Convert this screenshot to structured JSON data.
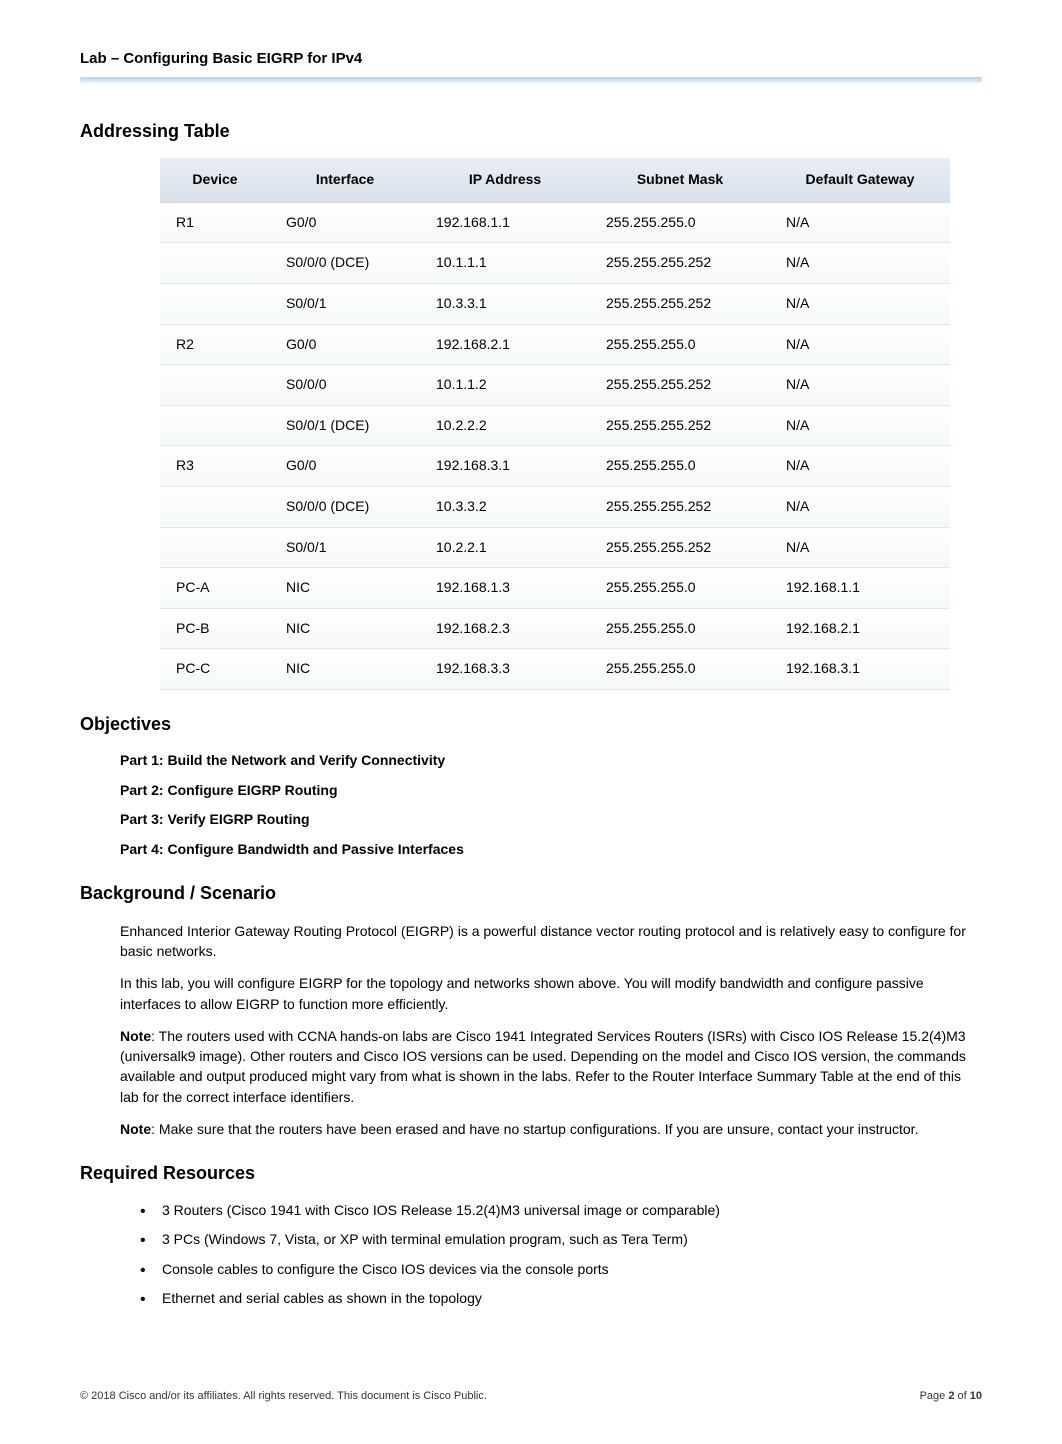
{
  "header": {
    "title": "Lab – Configuring Basic EIGRP for IPv4"
  },
  "sections": {
    "addressing_table": "Addressing Table",
    "objectives": "Objectives",
    "background": "Background / Scenario",
    "resources": "Required Resources"
  },
  "table": {
    "headers": {
      "device": "Device",
      "interface": "Interface",
      "ip": "IP Address",
      "mask": "Subnet Mask",
      "gateway": "Default Gateway"
    },
    "rows": [
      {
        "device": "R1",
        "interface": "G0/0",
        "ip": "192.168.1.1",
        "mask": "255.255.255.0",
        "gateway": "N/A"
      },
      {
        "device": "",
        "interface": "S0/0/0 (DCE)",
        "ip": "10.1.1.1",
        "mask": "255.255.255.252",
        "gateway": "N/A"
      },
      {
        "device": "",
        "interface": "S0/0/1",
        "ip": "10.3.3.1",
        "mask": "255.255.255.252",
        "gateway": "N/A"
      },
      {
        "device": "R2",
        "interface": "G0/0",
        "ip": "192.168.2.1",
        "mask": "255.255.255.0",
        "gateway": "N/A"
      },
      {
        "device": "",
        "interface": "S0/0/0",
        "ip": "10.1.1.2",
        "mask": "255.255.255.252",
        "gateway": "N/A"
      },
      {
        "device": "",
        "interface": "S0/0/1 (DCE)",
        "ip": "10.2.2.2",
        "mask": "255.255.255.252",
        "gateway": "N/A"
      },
      {
        "device": "R3",
        "interface": "G0/0",
        "ip": "192.168.3.1",
        "mask": "255.255.255.0",
        "gateway": "N/A"
      },
      {
        "device": "",
        "interface": "S0/0/0 (DCE)",
        "ip": "10.3.3.2",
        "mask": "255.255.255.252",
        "gateway": "N/A"
      },
      {
        "device": "",
        "interface": "S0/0/1",
        "ip": "10.2.2.1",
        "mask": "255.255.255.252",
        "gateway": "N/A"
      },
      {
        "device": "PC-A",
        "interface": "NIC",
        "ip": "192.168.1.3",
        "mask": "255.255.255.0",
        "gateway": "192.168.1.1"
      },
      {
        "device": "PC-B",
        "interface": "NIC",
        "ip": "192.168.2.3",
        "mask": "255.255.255.0",
        "gateway": "192.168.2.1"
      },
      {
        "device": "PC-C",
        "interface": "NIC",
        "ip": "192.168.3.3",
        "mask": "255.255.255.0",
        "gateway": "192.168.3.1"
      }
    ]
  },
  "objectives": {
    "items": [
      "Part 1: Build the Network and Verify Connectivity",
      "Part 2: Configure EIGRP Routing",
      "Part 3: Verify EIGRP Routing",
      "Part 4: Configure Bandwidth and Passive Interfaces"
    ]
  },
  "background": {
    "p1": "Enhanced Interior Gateway Routing Protocol (EIGRP) is a powerful distance vector routing protocol and is relatively easy to configure for basic networks.",
    "p2": "In this lab, you will configure EIGRP for the topology and networks shown above. You will modify bandwidth and configure passive interfaces to allow EIGRP to function more efficiently.",
    "note1_label": "Note",
    "note1_text": ": The routers used with CCNA hands-on labs are Cisco 1941 Integrated Services Routers (ISRs) with Cisco IOS Release 15.2(4)M3 (universalk9 image). Other routers and Cisco IOS versions can be used. Depending on the model and Cisco IOS version, the commands available and output produced might vary from what is shown in the labs. Refer to the Router Interface Summary Table at the end of this lab for the correct interface identifiers.",
    "note2_label": "Note",
    "note2_text": ": Make sure that the routers have been erased and have no startup configurations. If you are unsure, contact your instructor."
  },
  "resources": {
    "items": [
      "3 Routers (Cisco 1941 with Cisco IOS Release 15.2(4)M3 universal image or comparable)",
      "3 PCs (Windows 7, Vista, or XP with terminal emulation program, such as Tera Term)",
      "Console cables to configure the Cisco IOS devices via the console ports",
      "Ethernet and serial cables as shown in the topology"
    ]
  },
  "footer": {
    "copyright": "© 2018 Cisco and/or its affiliates. All rights reserved. This document is Cisco Public.",
    "page_label": "Page ",
    "page_current": "2",
    "page_of": " of ",
    "page_total": "10"
  }
}
